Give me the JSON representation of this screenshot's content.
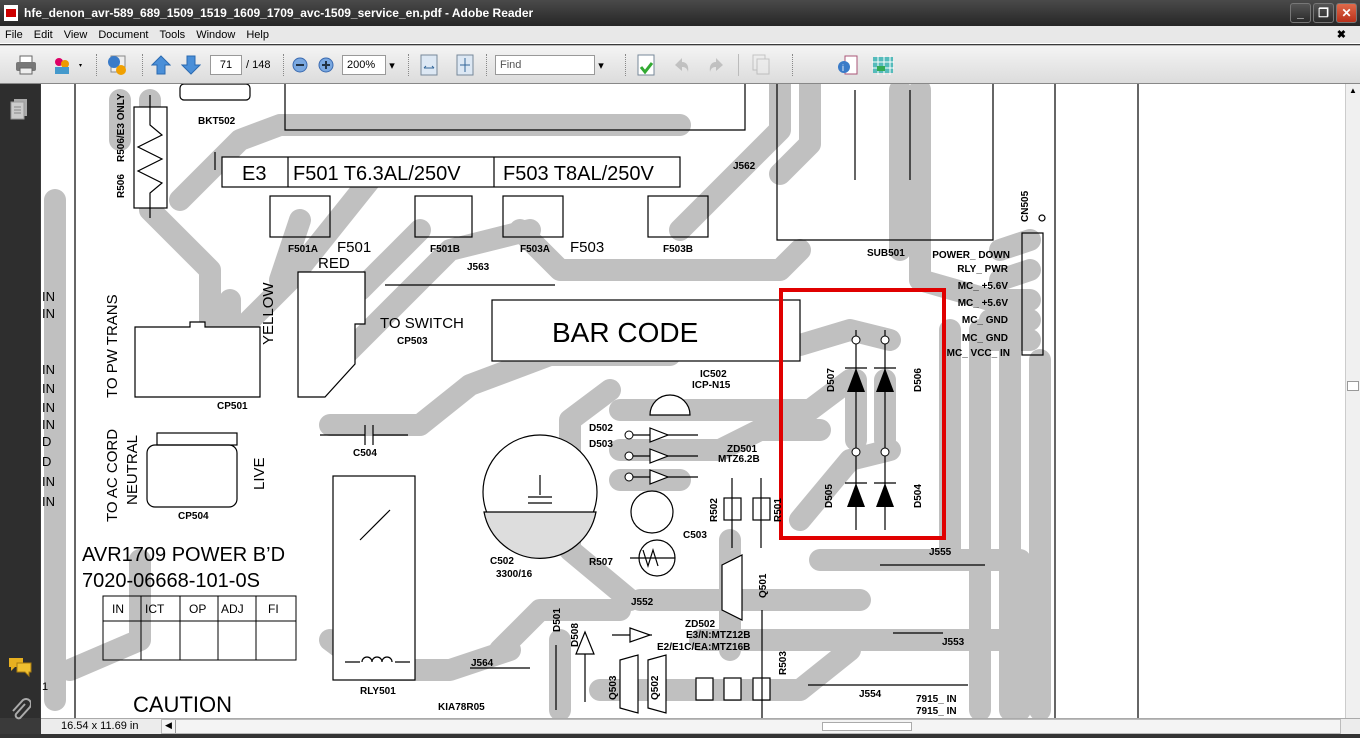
{
  "window": {
    "title": "hfe_denon_avr-589_689_1509_1519_1609_1709_avc-1509_service_en.pdf - Adobe Reader",
    "minimize": "_",
    "restore": "❐",
    "close": "✕"
  },
  "menu": [
    "File",
    "Edit",
    "View",
    "Document",
    "Tools",
    "Window",
    "Help"
  ],
  "menu_close": "✖",
  "toolbar": {
    "page_current": "71",
    "page_total": "/ 148",
    "zoom": "200%",
    "find_placeholder": "Find"
  },
  "status": {
    "page_size": "16.54 x 11.69 in"
  },
  "colors": {
    "highlight": "#e00000",
    "trace": "#c0c0c0"
  },
  "schematic": {
    "left_margin": [
      "IN",
      "IN",
      "IN",
      "IN",
      "IN",
      "IN",
      "D",
      "D",
      "IN",
      "IN",
      "1"
    ],
    "fuse_box": [
      "E3",
      "F501 T6.3AL/250V",
      "F503 T8AL/250V"
    ],
    "fuse_holders": [
      "F501A",
      "F501B",
      "F503A",
      "F503B"
    ],
    "fuse_names": [
      "F501",
      "F503"
    ],
    "bkt502": "BKT502",
    "r506": "R506",
    "r506_note": "R506/E3 ONLY",
    "j562": "J562",
    "j563": "J563",
    "sub501": "SUB501",
    "cn505": "CN505",
    "cn505_pins": [
      "POWER_ DOWN",
      "RLY_ PWR",
      "MC_ +5.6V",
      "MC_ +5.6V",
      "MC_ GND",
      "MC_ GND",
      "MC_ VCC_ IN"
    ],
    "red": "RED",
    "yellow": "YELLOW",
    "to_switch": "TO SWITCH",
    "cp503": "CP503",
    "to_pw_trans": "TO PW TRANS",
    "cp501": "CP501",
    "bar_code": "BAR CODE",
    "to_ac_cord": "TO AC CORD",
    "neutral": "NEUTRAL",
    "live": "LIVE",
    "cp504": "CP504",
    "c504": "C504",
    "ic502": "IC502",
    "icp": "ICP-N15",
    "d502": "D502",
    "d503": "D503",
    "zd501": "ZD501",
    "mtz62": "MTZ6.2B",
    "c502": "C502",
    "c502_val": "3300/16",
    "c503": "C503",
    "r502": "R502",
    "r501": "R501",
    "r507": "R507",
    "d507": "D507",
    "d506": "D506",
    "d505": "D505",
    "d504": "D504",
    "j555": "J555",
    "j552": "J552",
    "q501": "Q501",
    "zd502": "ZD502",
    "zd502_a": "E3/N:MTZ12B",
    "zd502_b": "E2/E1C/EA:MTZ16B",
    "d501": "D501",
    "d508": "D508",
    "j553": "J553",
    "j554": "J554",
    "r503": "R503",
    "q502": "Q502",
    "q503": "Q503",
    "j564": "J564",
    "rly501": "RLY501",
    "kia": "KIA78R05",
    "in1": "7915_ IN",
    "in2": "7915_ IN",
    "board_title": "AVR1709 POWER B’D",
    "board_part": "7020-06668-101-0S",
    "table_headers": [
      "IN",
      "ICT",
      "OP",
      "ADJ",
      "FI"
    ],
    "caution": "CAUTION"
  }
}
